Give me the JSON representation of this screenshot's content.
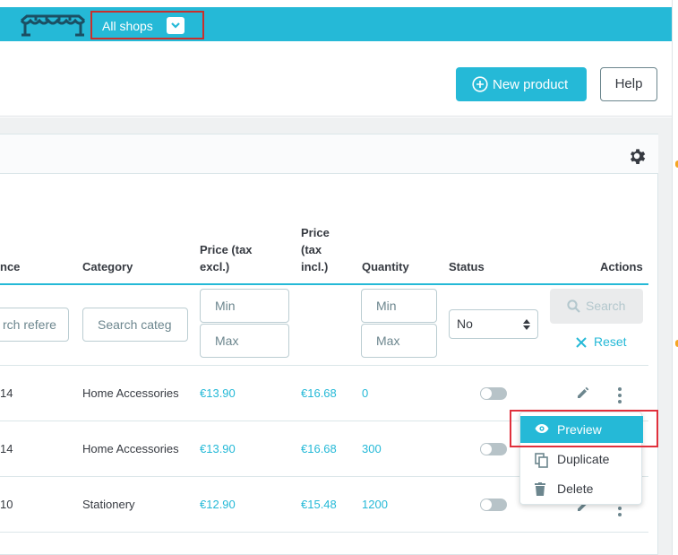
{
  "topbar": {
    "shop_selector": "All shops"
  },
  "header": {
    "new_product": "New product",
    "help": "Help"
  },
  "table": {
    "columns": {
      "reference": "nce",
      "category": "Category",
      "price_excl_1": "Price (tax",
      "price_excl_2": "excl.)",
      "price_incl_1": "Price",
      "price_incl_2": "(tax",
      "price_incl_3": "incl.)",
      "quantity": "Quantity",
      "status": "Status",
      "actions": "Actions"
    },
    "filters": {
      "reference_placeholder": "rch refere",
      "category_placeholder": "Search categ",
      "price_min": "Min",
      "price_max": "Max",
      "qty_min": "Min",
      "qty_max": "Max",
      "status_value": "No",
      "search_button": "Search",
      "reset_button": "Reset"
    },
    "rows": [
      {
        "reference": "14",
        "category": "Home Accessories",
        "price_excl": "€13.90",
        "price_incl": "€16.68",
        "quantity": "0",
        "status_enabled": false
      },
      {
        "reference": "14",
        "category": "Home Accessories",
        "price_excl": "€13.90",
        "price_incl": "€16.68",
        "quantity": "300",
        "status_enabled": false
      },
      {
        "reference": "10",
        "category": "Stationery",
        "price_excl": "€12.90",
        "price_incl": "€15.48",
        "quantity": "1200",
        "status_enabled": false
      }
    ]
  },
  "action_menu": {
    "preview": "Preview",
    "duplicate": "Duplicate",
    "delete": "Delete"
  },
  "colors": {
    "accent": "#25b9d7",
    "highlight": "#e0303c",
    "toggle_off": "#b7c3c8"
  },
  "icons": [
    "store-logo-icon",
    "chevron-down-icon",
    "plus-circle-icon",
    "gear-icon",
    "search-icon",
    "close-icon",
    "sort-arrows-icon",
    "pencil-icon",
    "more-vertical-icon",
    "eye-icon",
    "copy-icon",
    "trash-icon"
  ]
}
